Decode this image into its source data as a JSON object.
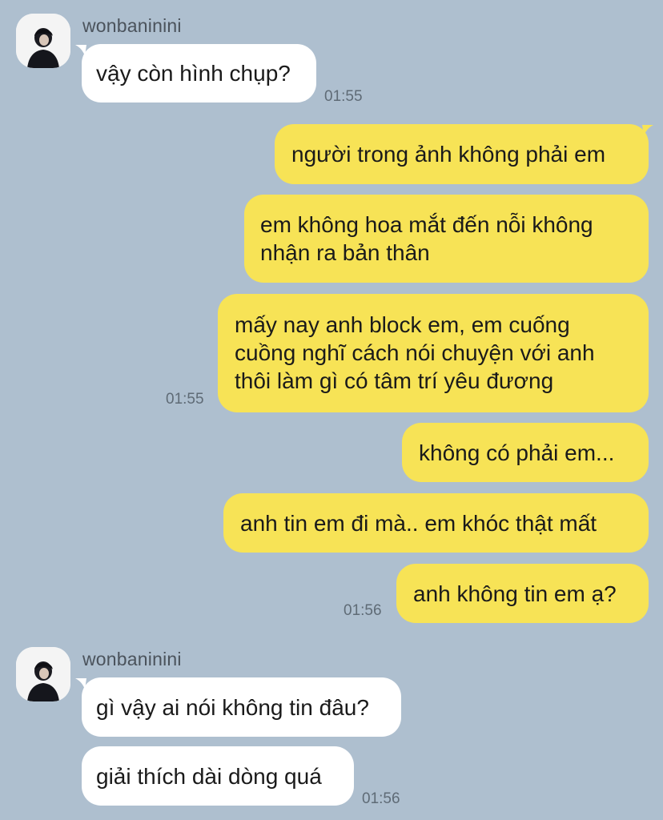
{
  "chat": {
    "sender_name": "wonbaninini",
    "messages": [
      {
        "text": "vậy còn hình chụp?",
        "time": "01:55"
      },
      {
        "text": "người trong ảnh không phải em"
      },
      {
        "line1": "em không hoa mắt đến nỗi không",
        "line2": "nhận ra bản thân"
      },
      {
        "line1": "mấy nay anh block em, em cuống",
        "line2": "cuồng nghĩ cách nói chuyện với anh",
        "line3": "thôi làm gì có tâm trí yêu đương",
        "time": "01:55"
      },
      {
        "text": "không có phải em..."
      },
      {
        "text": "anh tin em đi mà.. em khóc thật mất"
      },
      {
        "text": "anh không tin em ạ?",
        "time": "01:56"
      },
      {
        "text": "gì vậy ai nói không tin đâu?"
      },
      {
        "text": "giải thích dài dòng quá",
        "time": "01:56"
      }
    ]
  },
  "colors": {
    "background": "#aebfcf",
    "incoming_bubble": "#ffffff",
    "outgoing_bubble": "#f7e356"
  },
  "icons": {
    "avatar": "profile-photo"
  }
}
